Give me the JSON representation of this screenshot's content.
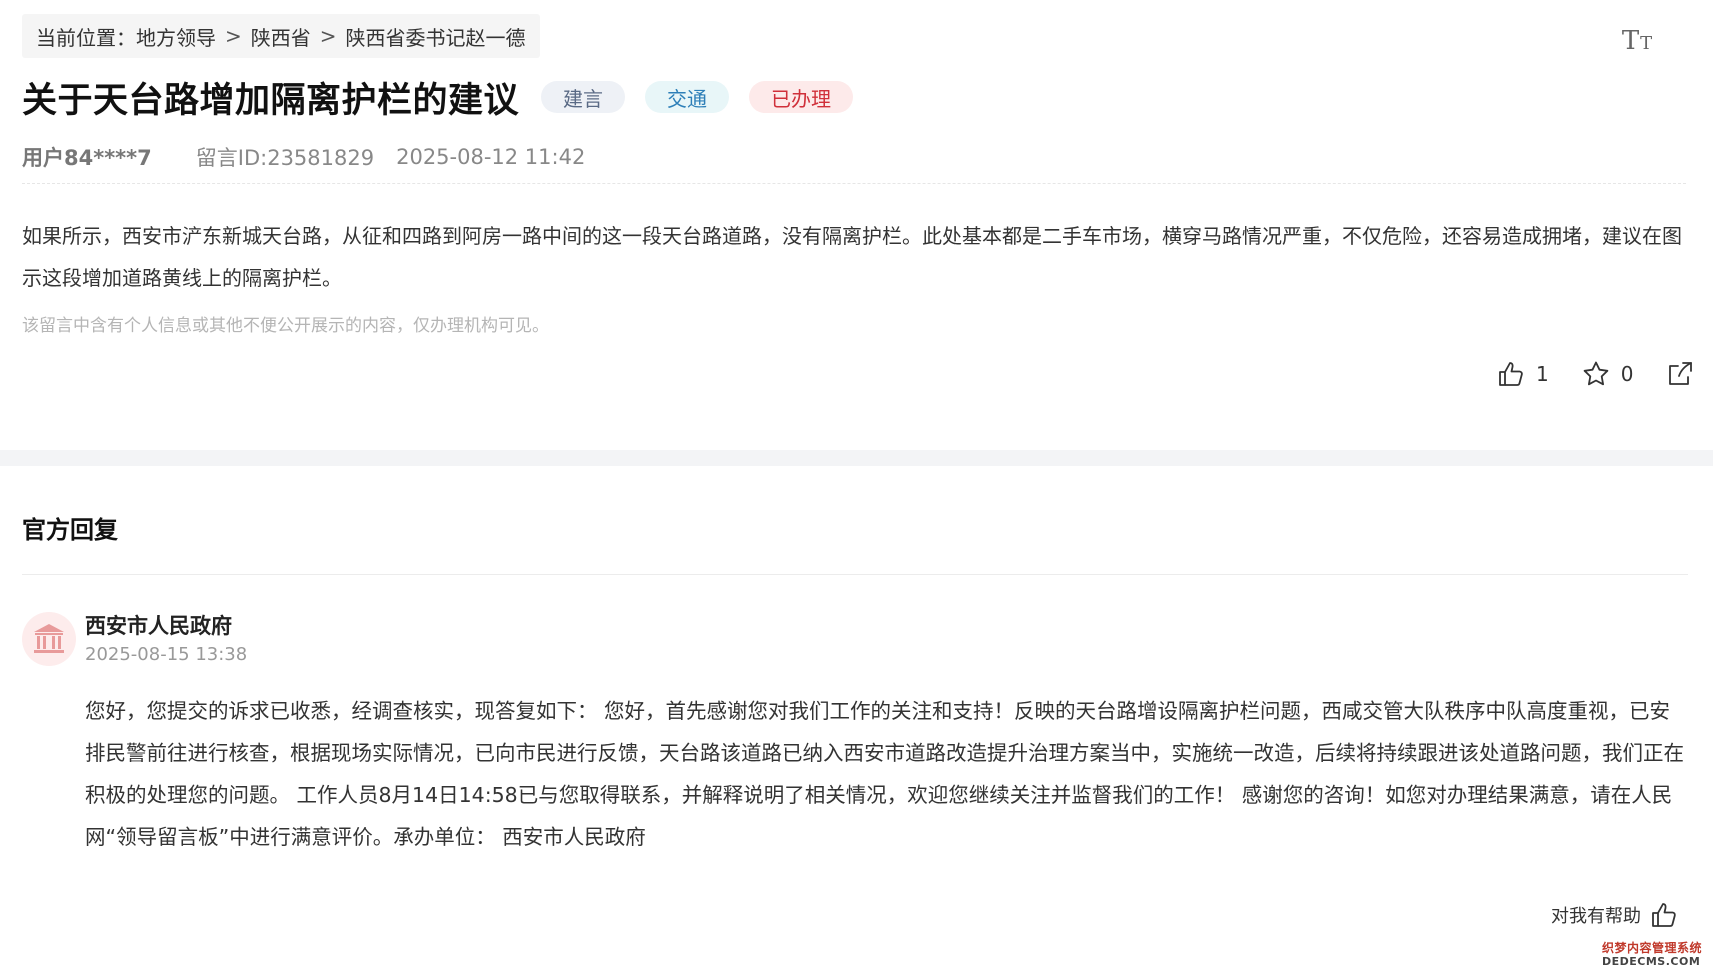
{
  "breadcrumb": {
    "prefix": "当前位置：",
    "items": [
      {
        "label": "地方领导"
      },
      {
        "label": "陕西省"
      },
      {
        "label": "陕西省委书记赵一德"
      }
    ],
    "separator": ">"
  },
  "font_toggle": {
    "icon": "font-size-icon",
    "big": "T",
    "small": "T"
  },
  "message": {
    "title": "关于天台路增加隔离护栏的建议",
    "tags": {
      "category": "建言",
      "domain": "交通",
      "status": "已办理"
    },
    "user": "用户84****7",
    "id_text": "留言ID:23581829",
    "datetime": "2025-08-12 11:42",
    "content": "如果所示，西安市浐东新城天台路，从征和四路到阿房一路中间的这一段天台路道路，没有隔离护栏。此处基本都是二手车市场，横穿马路情况严重，不仅危险，还容易造成拥堵，建议在图示这段增加道路黄线上的隔离护栏。",
    "privacy_note": "该留言中含有个人信息或其他不便公开展示的内容，仅办理机构可见。",
    "actions": {
      "like_count": "1",
      "favorite_count": "0"
    }
  },
  "reply": {
    "heading": "官方回复",
    "org": "西安市人民政府",
    "time": "2025-08-15 13:38",
    "content": "您好，您提交的诉求已收悉，经调查核实，现答复如下： 您好，首先感谢您对我们工作的关注和支持！反映的天台路增设隔离护栏问题，西咸交管大队秩序中队高度重视，已安排民警前往进行核查，根据现场实际情况，已向市民进行反馈，天台路该道路已纳入西安市道路改造提升治理方案当中，实施统一改造，后续将持续跟进该处道路问题，我们正在积极的处理您的问题。 工作人员8月14日14:58已与您取得联系，并解释说明了相关情况，欢迎您继续关注并监督我们的工作！ 感谢您的咨询！如您对办理结果满意，请在人民网“领导留言板”中进行满意评价。承办单位： 西安市人民政府",
    "helpful_label": "对我有帮助"
  },
  "watermark": {
    "top": "织梦内容管理系统",
    "bottom": "DEDECMS.COM"
  },
  "colors": {
    "status_red": "#d0303a",
    "domain_blue": "#2d7fb8",
    "avatar_bg": "#fdecec",
    "avatar_icon": "#e89a9a"
  }
}
